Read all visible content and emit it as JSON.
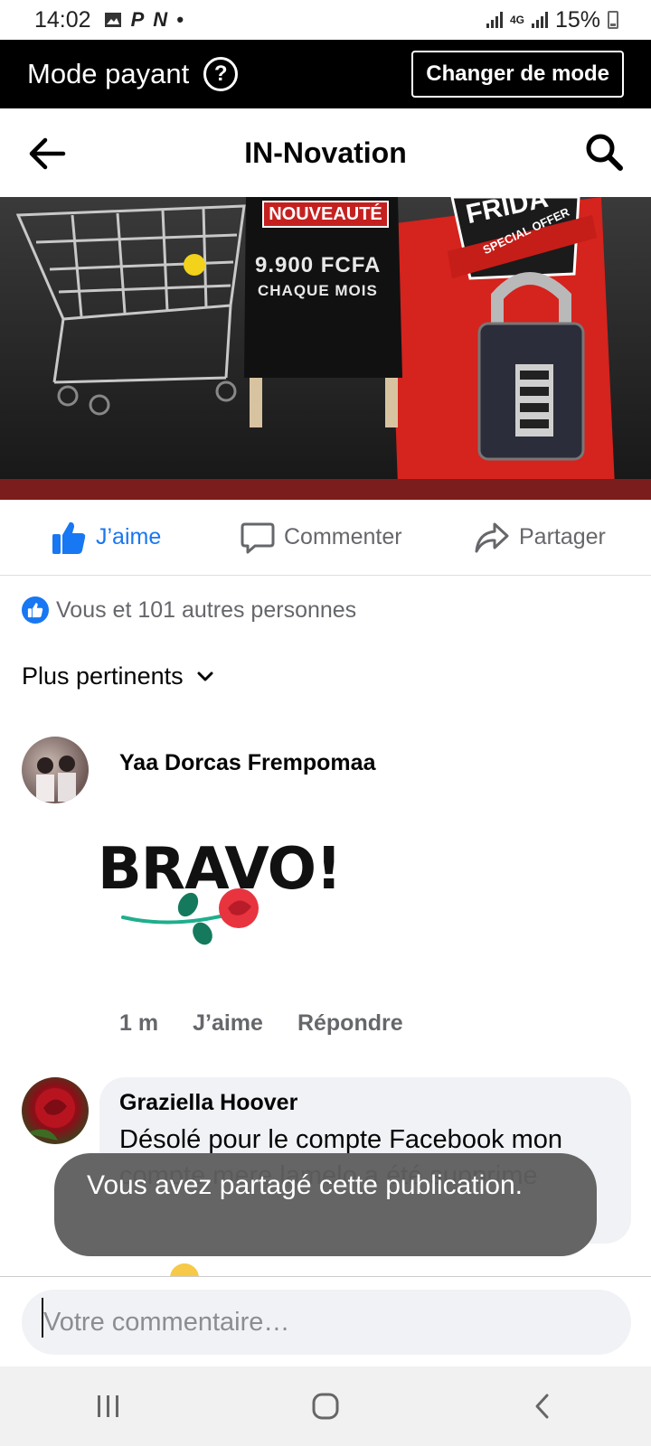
{
  "status_bar": {
    "time": "14:02",
    "icons": [
      "image-icon",
      "p-icon",
      "n-icon",
      "dot-icon"
    ],
    "network_label": "4G",
    "battery": "15%"
  },
  "mode_bar": {
    "title": "Mode payant",
    "help_glyph": "?",
    "button_label": "Changer de mode"
  },
  "nav": {
    "title": "IN-Novation",
    "back_icon": "arrow-left-icon",
    "search_icon": "search-icon"
  },
  "banner": {
    "new_tag": "NOUVEAUTÉ",
    "price": "9.900 FCFA",
    "subtitle": "CHAQUE MOIS",
    "offer_tag": "SPECIAL OFFER",
    "friday_tag": "FRIDA"
  },
  "actions": {
    "like": "J’aime",
    "comment": "Commenter",
    "share": "Partager",
    "like_color": "#1877f2"
  },
  "reactions": {
    "text": "Vous et 101 autres personnes"
  },
  "sort": {
    "label": "Plus pertinents"
  },
  "comments": [
    {
      "author": "Yaa Dorcas Frempomaa",
      "sticker_text": "BRAVO!",
      "time": "1 m",
      "like": "J’aime",
      "reply": "Répondre"
    },
    {
      "author": "Graziella Hoover",
      "text": "Désolé pour le compte Facebook mon compte mere lamelo a été supprime"
    }
  ],
  "toast": {
    "message": "Vous avez partagé cette publication."
  },
  "composer": {
    "placeholder": "Votre commentaire…"
  }
}
